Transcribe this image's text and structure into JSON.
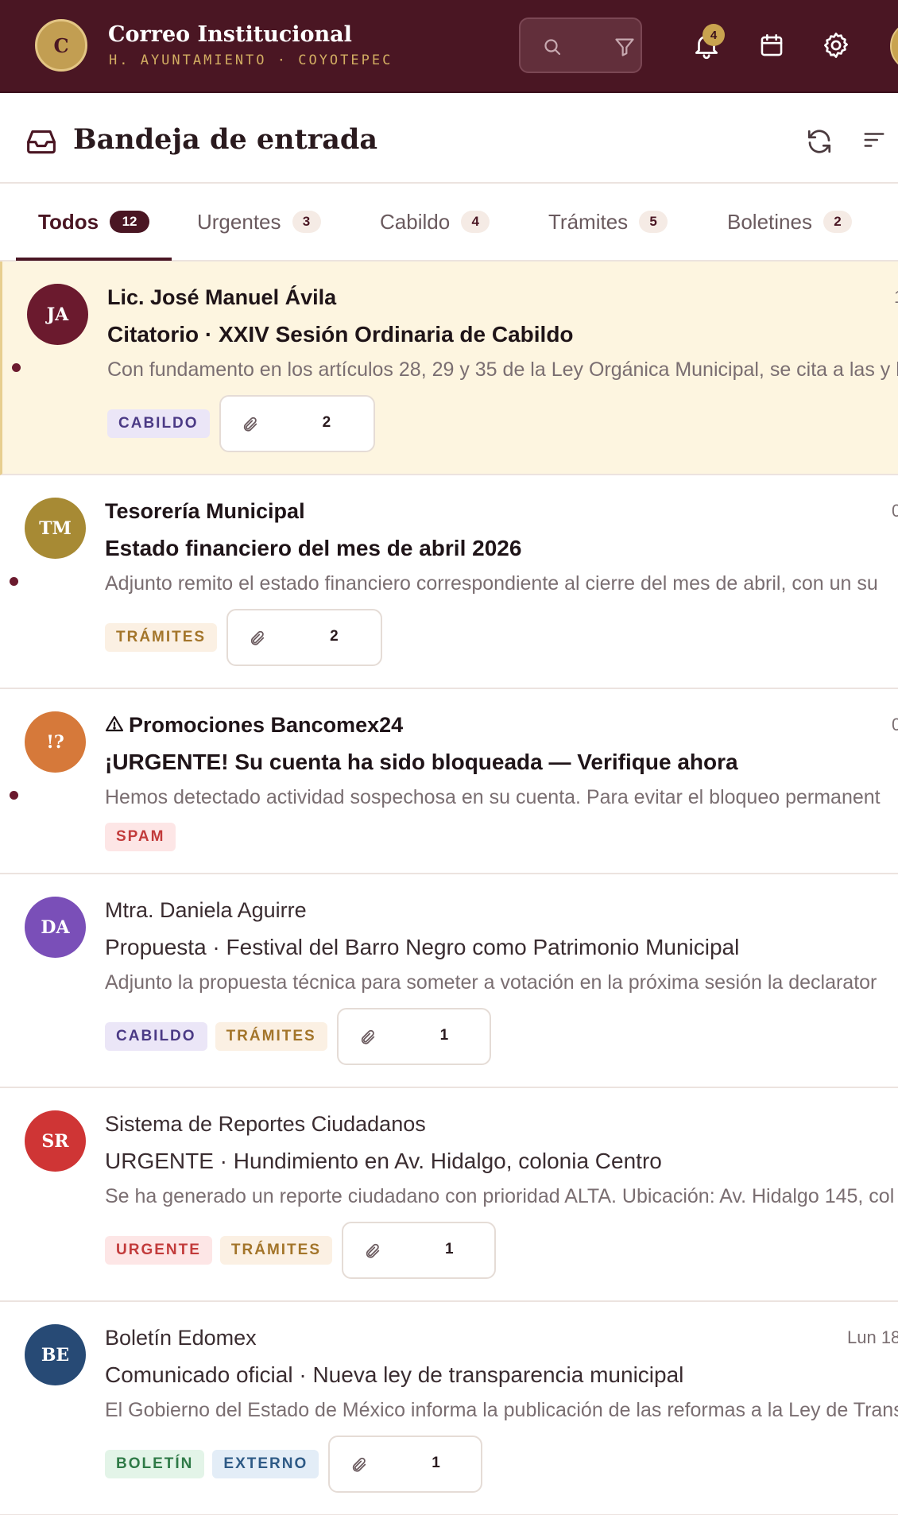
{
  "app": {
    "logo_letter": "C",
    "title": "Correo Institucional",
    "subtitle": "H. AYUNTAMIENTO · COYOTEPEC"
  },
  "topbar": {
    "notifications_count": "4",
    "icons": [
      "search-icon",
      "filter-icon",
      "bell-icon",
      "calendar-icon",
      "gear-icon"
    ]
  },
  "inbox": {
    "title": "Bandeja de entrada"
  },
  "tabs": [
    {
      "label": "Todos",
      "count": "12",
      "active": true
    },
    {
      "label": "Urgentes",
      "count": "3"
    },
    {
      "label": "Cabildo",
      "count": "4"
    },
    {
      "label": "Trámites",
      "count": "5"
    },
    {
      "label": "Boletines",
      "count": "2"
    }
  ],
  "messages": [
    {
      "initials": "JA",
      "avatar_color": "#6b1a2e",
      "sender": "Lic. José Manuel Ávila",
      "subject": "Citatorio · XXIV Sesión Ordinaria de Cabildo",
      "preview": "Con fundamento en los artículos 28, 29 y 35 de la Ley Orgánica Municipal, se cita a las y l",
      "date": "1",
      "tags": [
        "CABILDO"
      ],
      "attachments": "2",
      "unread": true,
      "selected": true
    },
    {
      "initials": "TM",
      "avatar_color": "#a78a34",
      "sender": "Tesorería Municipal",
      "subject": "Estado financiero del mes de abril 2026",
      "preview": "Adjunto remito el estado financiero correspondiente al cierre del mes de abril, con un su",
      "date": "0",
      "tags": [
        "TRÁMITES"
      ],
      "attachments": "2",
      "unread": true
    },
    {
      "initials": "!?",
      "avatar_color": "#d6793a",
      "sender": "Promociones Bancomex24",
      "subject": "¡URGENTE! Su cuenta ha sido bloqueada — Verifique ahora",
      "preview": "Hemos detectado actividad sospechosa en su cuenta. Para evitar el bloqueo permanent",
      "date": "0",
      "tags": [
        "SPAM"
      ],
      "unread": true,
      "warning": true
    },
    {
      "initials": "DA",
      "avatar_color": "#7a4fb8",
      "sender": "Mtra. Daniela Aguirre",
      "subject": "Propuesta · Festival del Barro Negro como Patrimonio Municipal",
      "preview": "Adjunto la propuesta técnica para someter a votación en la próxima sesión la declarator",
      "date": "",
      "tags": [
        "CABILDO",
        "TRÁMITES"
      ],
      "attachments": "1"
    },
    {
      "initials": "SR",
      "avatar_color": "#cf3535",
      "sender": "Sistema de Reportes Ciudadanos",
      "subject": "URGENTE · Hundimiento en Av. Hidalgo, colonia Centro",
      "preview": "Se ha generado un reporte ciudadano con prioridad ALTA. Ubicación: Av. Hidalgo 145, col",
      "date": "",
      "tags": [
        "URGENTE",
        "TRÁMITES"
      ],
      "attachments": "1"
    },
    {
      "initials": "BE",
      "avatar_color": "#274a75",
      "sender": "Boletín Edomex",
      "subject": "Comunicado oficial · Nueva ley de transparencia municipal",
      "preview": "El Gobierno del Estado de México informa la publicación de las reformas a la Ley de Trans",
      "date": "Lun 18",
      "tags": [
        "BOLETÍN",
        "EXTERNO"
      ],
      "attachments": "1"
    }
  ]
}
